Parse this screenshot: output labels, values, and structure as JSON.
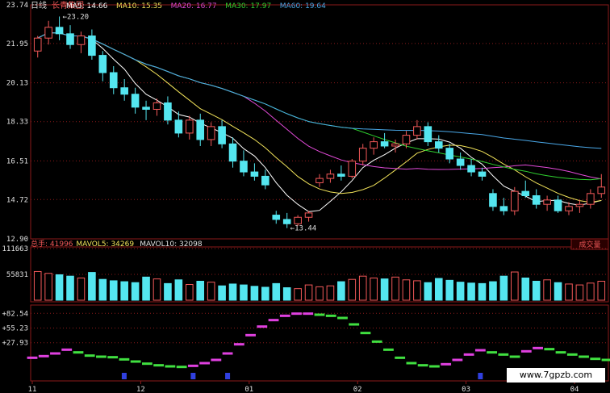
{
  "header": {
    "period": "日线",
    "stock_name": "长青集团",
    "ma": [
      {
        "label": "MA5: 14.66",
        "color": "#ffffff"
      },
      {
        "label": "MA10: 15.35",
        "color": "#f2e35a"
      },
      {
        "label": "MA20: 16.77",
        "color": "#e24ad8"
      },
      {
        "label": "MA30: 17.97",
        "color": "#2fd12f"
      },
      {
        "label": "MA60: 19.64",
        "color": "#4aa8e8"
      }
    ]
  },
  "volume_header": {
    "items": [
      {
        "label": "总手: 41996",
        "color": "#f25858"
      },
      {
        "label": "MAVOL5: 34269",
        "color": "#f2e35a"
      },
      {
        "label": "MAVOL10: 32098",
        "color": "#e0e0e0"
      }
    ],
    "right_tab": "成交量"
  },
  "watermark": "www.7gpzb.com",
  "colors": {
    "up": "#f25858",
    "down": "#54e6f0",
    "grid": "#8b1a1a",
    "axis_label": "#e0e0e0"
  },
  "chart_data": [
    {
      "type": "candlestick",
      "title": "日线 长青集团",
      "ylim": [
        12.9,
        23.74
      ],
      "y_ticks": [
        "23.74",
        "21.95",
        "20.13",
        "18.33",
        "16.51",
        "14.72",
        "12.90"
      ],
      "x_ticks": [
        "11",
        "12",
        "01",
        "02",
        "03",
        "04"
      ],
      "annotations": [
        "←23.20",
        "←13.44"
      ],
      "candles_ohlc": [
        [
          21.6,
          22.3,
          21.3,
          22.2
        ],
        [
          22.2,
          23.0,
          21.9,
          22.7
        ],
        [
          22.7,
          23.2,
          22.1,
          22.4
        ],
        [
          22.4,
          22.8,
          21.7,
          21.9
        ],
        [
          21.9,
          22.5,
          21.5,
          22.3
        ],
        [
          22.3,
          22.6,
          21.2,
          21.4
        ],
        [
          21.4,
          21.6,
          20.2,
          20.6
        ],
        [
          20.6,
          20.9,
          19.6,
          19.9
        ],
        [
          19.9,
          20.3,
          19.3,
          19.6
        ],
        [
          19.6,
          19.9,
          18.7,
          19.0
        ],
        [
          19.0,
          19.3,
          18.4,
          18.9
        ],
        [
          18.9,
          19.4,
          18.6,
          19.2
        ],
        [
          19.2,
          19.5,
          18.2,
          18.4
        ],
        [
          18.4,
          18.8,
          17.6,
          17.8
        ],
        [
          17.8,
          18.6,
          17.5,
          18.4
        ],
        [
          18.4,
          18.7,
          17.2,
          17.5
        ],
        [
          17.5,
          18.3,
          17.2,
          18.1
        ],
        [
          18.1,
          18.4,
          17.1,
          17.3
        ],
        [
          17.3,
          17.6,
          16.2,
          16.5
        ],
        [
          16.5,
          17.0,
          15.8,
          16.0
        ],
        [
          16.0,
          16.4,
          15.6,
          15.8
        ],
        [
          15.8,
          16.1,
          15.2,
          15.4
        ],
        [
          14.0,
          14.2,
          13.6,
          13.8
        ],
        [
          13.8,
          14.1,
          13.4,
          13.6
        ],
        [
          13.6,
          14.0,
          13.5,
          13.9
        ],
        [
          13.9,
          14.2,
          13.7,
          14.1
        ],
        [
          15.5,
          15.9,
          15.3,
          15.7
        ],
        [
          15.7,
          16.1,
          15.5,
          15.9
        ],
        [
          15.9,
          16.3,
          15.6,
          15.8
        ],
        [
          15.8,
          16.6,
          15.7,
          16.5
        ],
        [
          16.5,
          17.3,
          16.3,
          17.1
        ],
        [
          17.1,
          17.6,
          16.8,
          17.4
        ],
        [
          17.4,
          17.8,
          17.1,
          17.2
        ],
        [
          17.2,
          17.5,
          16.9,
          17.3
        ],
        [
          17.3,
          17.9,
          17.1,
          17.7
        ],
        [
          17.7,
          18.4,
          17.5,
          18.1
        ],
        [
          18.1,
          18.3,
          17.2,
          17.4
        ],
        [
          17.4,
          17.7,
          16.9,
          17.1
        ],
        [
          17.1,
          17.3,
          16.4,
          16.6
        ],
        [
          16.6,
          16.9,
          16.1,
          16.3
        ],
        [
          16.3,
          16.6,
          15.8,
          16.0
        ],
        [
          16.0,
          16.2,
          15.6,
          15.8
        ],
        [
          15.0,
          15.2,
          14.2,
          14.4
        ],
        [
          14.4,
          14.8,
          14.0,
          14.2
        ],
        [
          14.2,
          15.3,
          14.0,
          15.1
        ],
        [
          15.1,
          15.6,
          14.8,
          14.9
        ],
        [
          14.9,
          15.2,
          14.3,
          14.5
        ],
        [
          14.5,
          14.9,
          14.2,
          14.7
        ],
        [
          14.7,
          14.9,
          14.1,
          14.2
        ],
        [
          14.2,
          14.6,
          14.0,
          14.4
        ],
        [
          14.4,
          14.7,
          14.1,
          14.5
        ],
        [
          14.5,
          15.2,
          14.3,
          15.0
        ],
        [
          15.0,
          15.9,
          14.8,
          15.3
        ]
      ]
    },
    {
      "type": "bar",
      "title": "总手",
      "ylim": [
        0,
        111663
      ],
      "y_ticks": [
        "111663",
        "55831"
      ],
      "volumes": [
        62000,
        58000,
        55000,
        52000,
        48000,
        60000,
        45000,
        42000,
        40000,
        38000,
        50000,
        46000,
        36000,
        44000,
        34000,
        41000,
        39000,
        31000,
        35000,
        33000,
        30000,
        28000,
        36000,
        27000,
        25000,
        33000,
        29000,
        31000,
        40000,
        45000,
        52000,
        48000,
        46000,
        50000,
        44000,
        42000,
        38000,
        47000,
        43000,
        39000,
        37000,
        36000,
        40000,
        52000,
        61000,
        48000,
        41000,
        44000,
        38000,
        35000,
        33000,
        37000,
        41000
      ]
    },
    {
      "type": "scatter",
      "title": "oscillator",
      "ylim": [
        -40,
        95
      ],
      "y_ticks": [
        "+82.54",
        "+55.23",
        "+27.93"
      ],
      "values": [
        0,
        3,
        8,
        15,
        10,
        4,
        2,
        1,
        -3,
        -7,
        -11,
        -14,
        -16,
        -17,
        -15,
        -10,
        -4,
        8,
        25,
        42,
        58,
        70,
        78,
        82,
        82,
        80,
        78,
        74,
        62,
        46,
        30,
        15,
        0,
        -10,
        -14,
        -16,
        -12,
        -4,
        6,
        14,
        10,
        6,
        2,
        12,
        18,
        16,
        10,
        6,
        2,
        -2,
        -4
      ],
      "markers_at": [
        8,
        14,
        17,
        39
      ]
    }
  ]
}
